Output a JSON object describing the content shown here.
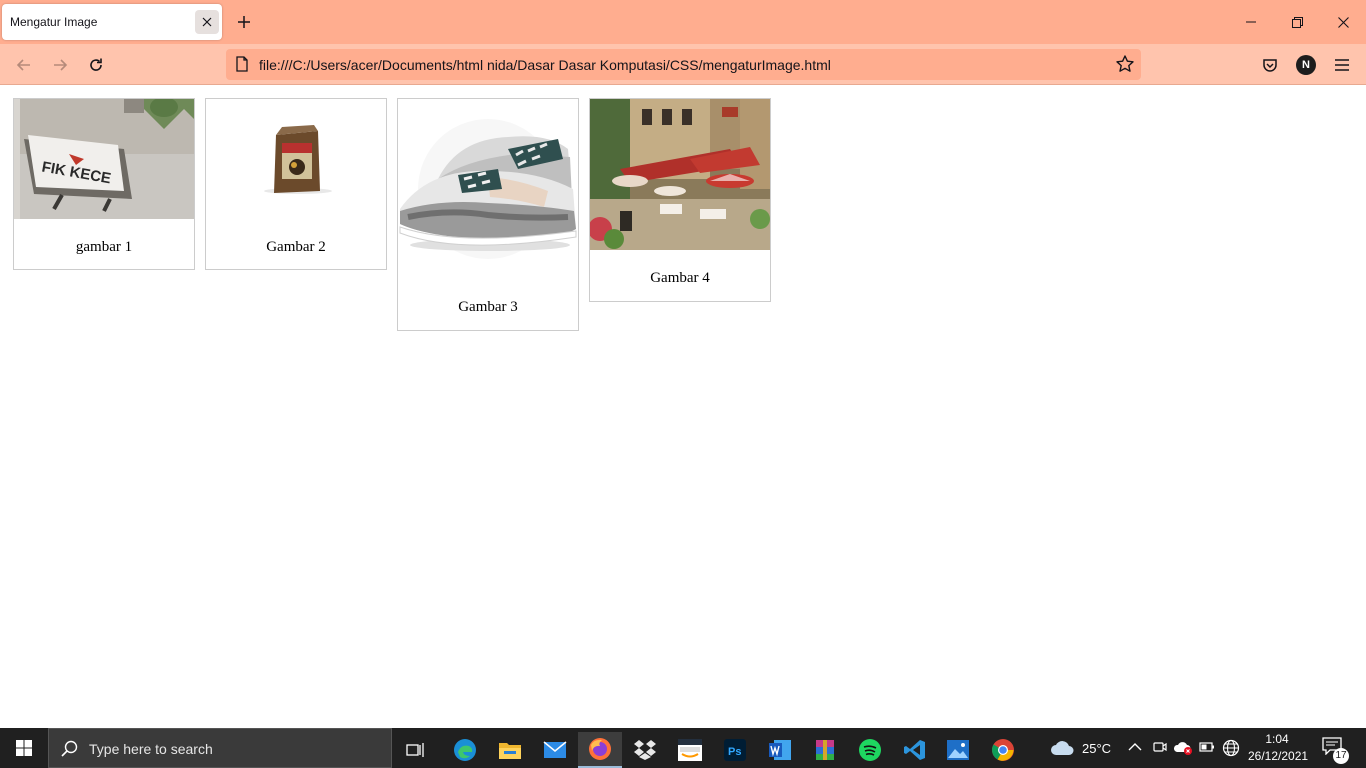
{
  "browser": {
    "tab_title": "Mengatur Image",
    "url": "file:///C:/Users/acer/Documents/html nida/Dasar Dasar Komputasi/CSS/mengaturImage.html",
    "profile_initial": "N"
  },
  "gallery": {
    "cards": [
      {
        "caption": "gambar 1",
        "image": "t-shirt-photo",
        "image_text": "FIK KECE"
      },
      {
        "caption": "Gambar 2",
        "image": "coffee-bag-photo"
      },
      {
        "caption": "Gambar 3",
        "image": "sneakers-photo"
      },
      {
        "caption": "Gambar 4",
        "image": "cafe-painting"
      }
    ]
  },
  "taskbar": {
    "search_placeholder": "Type here to search",
    "weather": "25°C",
    "time": "1:04",
    "date": "26/12/2021",
    "notification_count": "17",
    "apps": [
      "task-view",
      "edge",
      "file-explorer",
      "mail",
      "firefox",
      "dropbox",
      "amazon",
      "photoshop",
      "word",
      "winrar",
      "spotify",
      "vscode",
      "photos",
      "chrome"
    ]
  },
  "colors": {
    "tabbar": "#ffad8f",
    "navbar": "#ffc4ad",
    "taskbar": "#202020"
  }
}
